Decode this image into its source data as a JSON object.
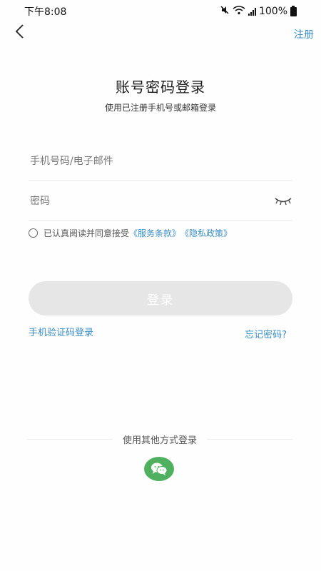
{
  "status_bar": {
    "time": "下午8:08",
    "battery": "100%",
    "icons": [
      "mute-icon",
      "wifi-icon",
      "signal-icon",
      "battery-icon"
    ]
  },
  "nav": {
    "back_icon": "chevron-left-icon",
    "register_label": "注册"
  },
  "header": {
    "title": "账号密码登录",
    "subtitle": "使用已注册手机号或邮箱登录"
  },
  "form": {
    "phone_placeholder": "手机号码/电子邮件",
    "password_placeholder": "密码",
    "eye_icon": "eye-closed-icon"
  },
  "agreement": {
    "prefix": "已认真阅读并同意接受",
    "service_terms": "《服务条款》",
    "privacy_policy": "《隐私政策》"
  },
  "actions": {
    "login_label": "登录",
    "sms_login": "手机验证码登录",
    "forgot_password": "忘记密码?"
  },
  "other_login": {
    "label": "使用其他方式登录",
    "wechat_icon": "wechat-icon"
  },
  "colors": {
    "accent": "#3a8fc7",
    "login_button_disabled": "#e6e6e6",
    "wechat_green": "#4fb160"
  }
}
